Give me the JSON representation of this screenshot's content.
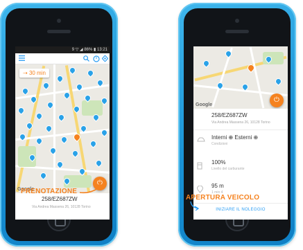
{
  "left_screen": {
    "status_text": "9 ▽ ◢ 86% ▮ 13:21",
    "toolbar": {
      "menu_icon": "menu-icon",
      "search_icon": "search-icon",
      "timer_icon": "timer-icon",
      "location_icon": "location-icon"
    },
    "time_chip": "30 min",
    "map_attribution": "Google",
    "card": {
      "plate": "258/EZ687ZW",
      "address": "Via Andrea Massena 26, 10128 Torino"
    },
    "callout": "PRENOTAZIONE"
  },
  "right_screen": {
    "map_attribution": "Google",
    "plate": "258/EZ687ZW",
    "address": "Via Andrea Massena 26, 10128 Torino",
    "cleanliness": {
      "interni": "Interni",
      "esterni": "Esterni",
      "sub": "Condizioni"
    },
    "fuel": {
      "value": "100%",
      "sub": "Livello del carburante"
    },
    "distance": {
      "value": "95 m",
      "sub": "1 min 4"
    },
    "callout": "APERTURA VEICOLO",
    "cta": "INIZIARE IL NOLEGGIO"
  },
  "colors": {
    "accent_orange": "#f5821f",
    "pin_blue": "#2aa2e8",
    "phone_blue": "#1a93d6",
    "link_blue": "#2a9df4"
  }
}
